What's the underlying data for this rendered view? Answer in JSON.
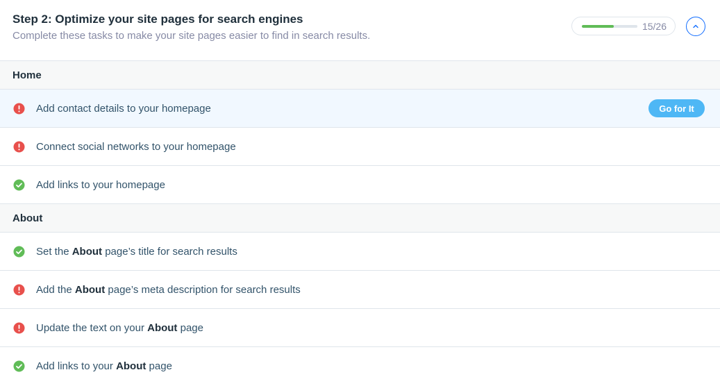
{
  "header": {
    "title": "Step 2: Optimize your site pages for search engines",
    "subtitle": "Complete these tasks to make your site pages easier to find in search results.",
    "progress": {
      "completed": 15,
      "total": 26,
      "label": "15/26"
    },
    "collapse_icon": "chevron-up-icon"
  },
  "colors": {
    "error": "#e8504c",
    "success": "#60bc57",
    "accent": "#116dff",
    "button": "#4eb7f5"
  },
  "sections": [
    {
      "title": "Home",
      "tasks": [
        {
          "status": "error",
          "text": "Add contact details to your homepage",
          "action": "Go for It"
        },
        {
          "status": "error",
          "text": "Connect social networks to your homepage"
        },
        {
          "status": "done",
          "text": "Add links to your homepage"
        }
      ]
    },
    {
      "title": "About",
      "tasks": [
        {
          "status": "done",
          "pre": "Set the ",
          "bold": "About",
          "post": " page’s title for search results"
        },
        {
          "status": "error",
          "pre": "Add the ",
          "bold": "About",
          "post": " page’s meta description for search results"
        },
        {
          "status": "error",
          "pre": "Update the text on your ",
          "bold": "About",
          "post": " page"
        },
        {
          "status": "done",
          "pre": "Add links to your ",
          "bold": "About",
          "post": " page"
        }
      ]
    }
  ]
}
